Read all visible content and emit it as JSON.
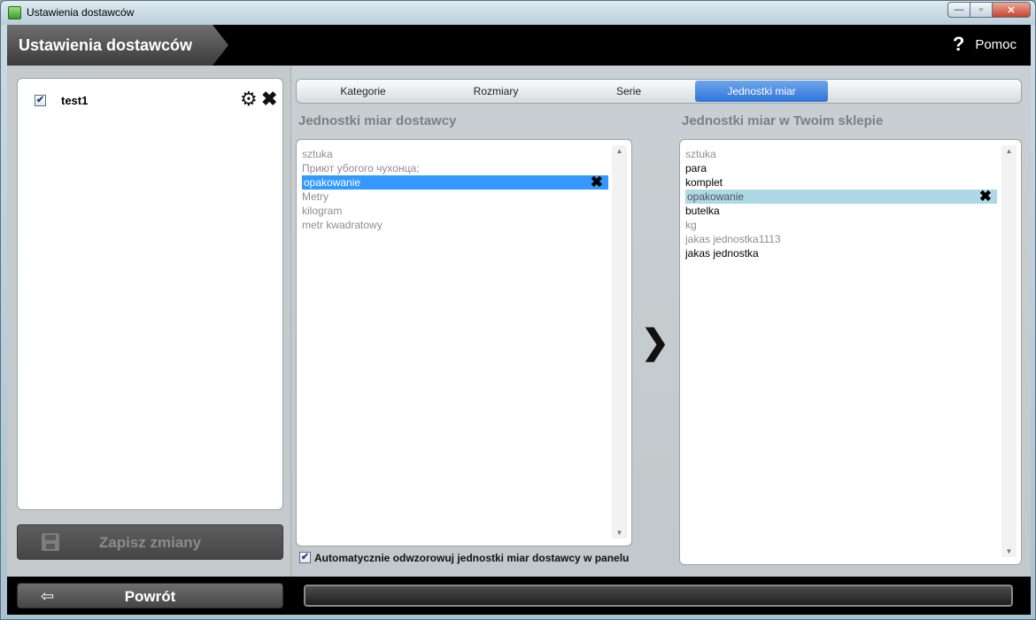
{
  "window": {
    "title": "Ustawienia dostawców",
    "minimize": "—",
    "maximize": "▫",
    "close": "✕"
  },
  "header": {
    "title": "Ustawienia dostawców",
    "help_icon": "?",
    "help_label": "Pomoc"
  },
  "suppliers": [
    {
      "name": "test1",
      "checked": "✔",
      "settings_icon": "⚙",
      "delete_icon": "✖"
    }
  ],
  "save_button": {
    "label": "Zapisz zmiany"
  },
  "tabs": [
    {
      "label": "Kategorie"
    },
    {
      "label": "Rozmiary"
    },
    {
      "label": "Serie"
    },
    {
      "label": "Jednostki miar"
    }
  ],
  "supplier_units": {
    "title": "Jednostki miar dostawcy",
    "items": [
      "sztuka",
      "Приют убогого чухонца;",
      "opakowanie",
      "Metry",
      "kilogram",
      "metr kwadratowy"
    ],
    "remove_icon": "✖"
  },
  "shop_units": {
    "title": "Jednostki miar w Twoim sklepie",
    "items": [
      "sztuka",
      "para",
      "komplet",
      "opakowanie",
      "butelka",
      "kg",
      "jakas jednostka1113",
      "jakas jednostka"
    ],
    "remove_icon": "✖"
  },
  "map_arrow": "❯",
  "scroll": {
    "up": "▲",
    "down": "▼"
  },
  "auto_map": {
    "checked": "✔",
    "label": "Automatycznie odwzorowuj jednostki miar dostawcy w panelu"
  },
  "back_button": {
    "icon": "⇦",
    "label": "Powrót"
  }
}
